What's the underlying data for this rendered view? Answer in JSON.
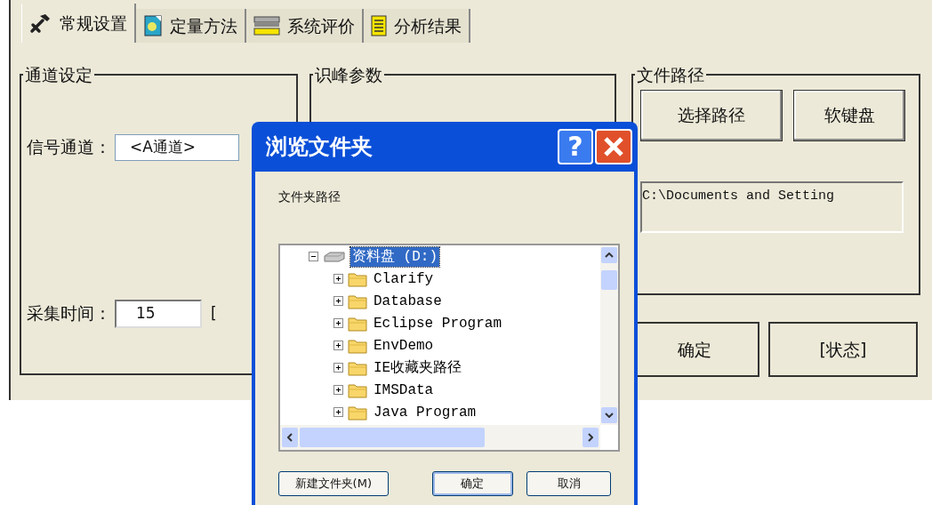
{
  "tabs": [
    {
      "label": "常规设置",
      "selected": true
    },
    {
      "label": "定量方法",
      "selected": false
    },
    {
      "label": "系统评价",
      "selected": false
    },
    {
      "label": "分析结果",
      "selected": false
    }
  ],
  "channel_group": {
    "title": "通道设定",
    "signal_label": "信号通道：",
    "signal_value": "<A通道>",
    "time_label": "采集时间：",
    "time_value": "15",
    "time_unit": "["
  },
  "peak_group": {
    "title": "识峰参数"
  },
  "path_group": {
    "title": "文件路径",
    "buttons": [
      "选择路径",
      "软键盘"
    ],
    "path_value": "C:\\Documents and Setting"
  },
  "bottom_buttons": [
    "确定",
    "[状态]"
  ],
  "dialog": {
    "title": "浏览文件夹",
    "help": "?",
    "prompt": "文件夹路径",
    "tree": {
      "label": "资料盘 (D:)",
      "expanded": true,
      "selected": true,
      "children": [
        {
          "label": "Clarify",
          "expanded": false,
          "selected": false
        },
        {
          "label": "Database",
          "expanded": false,
          "selected": false
        },
        {
          "label": "Eclipse Program",
          "expanded": false,
          "selected": false
        },
        {
          "label": "EnvDemo",
          "expanded": false,
          "selected": false
        },
        {
          "label": "IE收藏夹路径",
          "expanded": false,
          "selected": false
        },
        {
          "label": "IMSData",
          "expanded": false,
          "selected": false
        },
        {
          "label": "Java Program",
          "expanded": false,
          "selected": false
        }
      ]
    },
    "buttons": [
      "新建文件夹(M)",
      "确定",
      "取消"
    ]
  }
}
